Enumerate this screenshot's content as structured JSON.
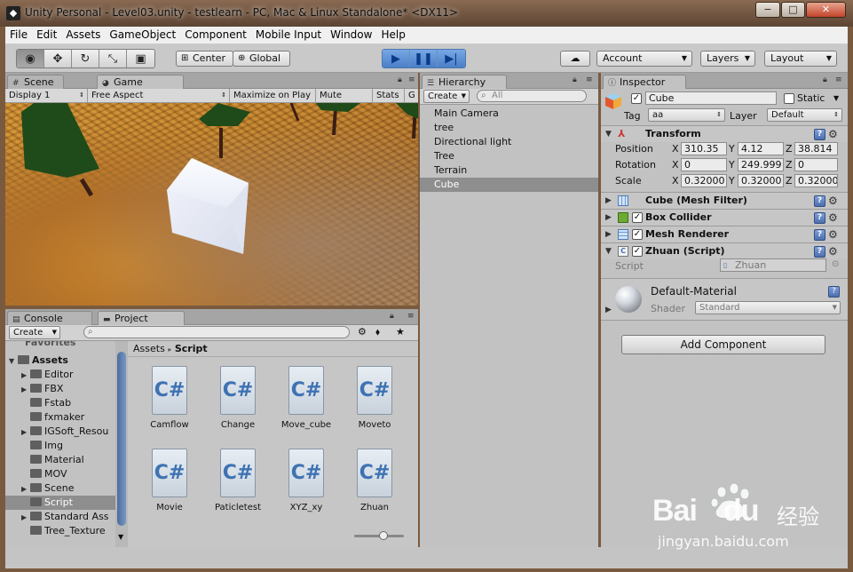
{
  "window": {
    "title": "Unity Personal - Level03.unity - testlearn - PC, Mac & Linux Standalone* <DX11>",
    "minimize": "−",
    "maximize": "□",
    "close": "✕"
  },
  "menu": [
    "File",
    "Edit",
    "Assets",
    "GameObject",
    "Component",
    "Mobile Input",
    "Window",
    "Help"
  ],
  "toolbar": {
    "pivot": "Center",
    "space": "Global",
    "account": "Account",
    "layers": "Layers",
    "layout": "Layout"
  },
  "scene_panel": {
    "tab_scene": "Scene",
    "tab_game": "Game",
    "display": "Display 1",
    "aspect": "Free Aspect",
    "maximize": "Maximize on Play",
    "mute": "Mute audio",
    "stats": "Stats",
    "gizmos": "G"
  },
  "hierarchy": {
    "tab": "Hierarchy",
    "create": "Create",
    "search_placeholder": "All",
    "items": [
      "Main Camera",
      "tree",
      "Directional light",
      "Tree",
      "Terrain",
      "Cube"
    ]
  },
  "inspector": {
    "tab": "Inspector",
    "object_name": "Cube",
    "static_label": "Static",
    "tag_label": "Tag",
    "tag_value": "aa",
    "layer_label": "Layer",
    "layer_value": "Default",
    "transform": {
      "title": "Transform",
      "position_label": "Position",
      "rotation_label": "Rotation",
      "scale_label": "Scale",
      "x": "X",
      "y": "Y",
      "z": "Z",
      "position": [
        "310.35",
        "4.12",
        "38.814"
      ],
      "rotation": [
        "0",
        "249.999",
        "0"
      ],
      "scale": [
        "0.32000",
        "0.32000",
        "0.32000"
      ]
    },
    "mesh_filter": "Cube (Mesh Filter)",
    "box_collider": "Box Collider",
    "mesh_renderer": "Mesh Renderer",
    "script_component": "Zhuan (Script)",
    "script_label": "Script",
    "script_value": "Zhuan",
    "material_name": "Default-Material",
    "shader_label": "Shader",
    "shader_value": "Standard",
    "add_component": "Add Component"
  },
  "project": {
    "tab_console": "Console",
    "tab_project": "Project",
    "create": "Create",
    "favorites": "Favorites",
    "breadcrumb_root": "Assets",
    "breadcrumb_sep": "▸",
    "breadcrumb_current": "Script",
    "tree": [
      {
        "label": "Assets",
        "level": 0,
        "expanded": true,
        "bold": true
      },
      {
        "label": "Editor",
        "level": 1,
        "arrow": true
      },
      {
        "label": "FBX",
        "level": 1,
        "arrow": true
      },
      {
        "label": "Fstab",
        "level": 1
      },
      {
        "label": "fxmaker",
        "level": 1
      },
      {
        "label": "IGSoft_Resou",
        "level": 1,
        "arrow": true
      },
      {
        "label": "Img",
        "level": 1
      },
      {
        "label": "Material",
        "level": 1
      },
      {
        "label": "MOV",
        "level": 1
      },
      {
        "label": "Scene",
        "level": 1,
        "arrow": true
      },
      {
        "label": "Script",
        "level": 1,
        "selected": true
      },
      {
        "label": "Standard Ass",
        "level": 1,
        "arrow": true
      },
      {
        "label": "Tree_Texture",
        "level": 1
      }
    ],
    "assets": [
      "Camflow",
      "Change",
      "Move_cube",
      "Moveto",
      "Movie",
      "Paticletest",
      "XYZ_xy",
      "Zhuan"
    ],
    "asset_glyph": "C#"
  },
  "watermark": {
    "brand": "Bai",
    "brand2": "du",
    "cn": "经验",
    "url": "jingyan.baidu.com"
  }
}
